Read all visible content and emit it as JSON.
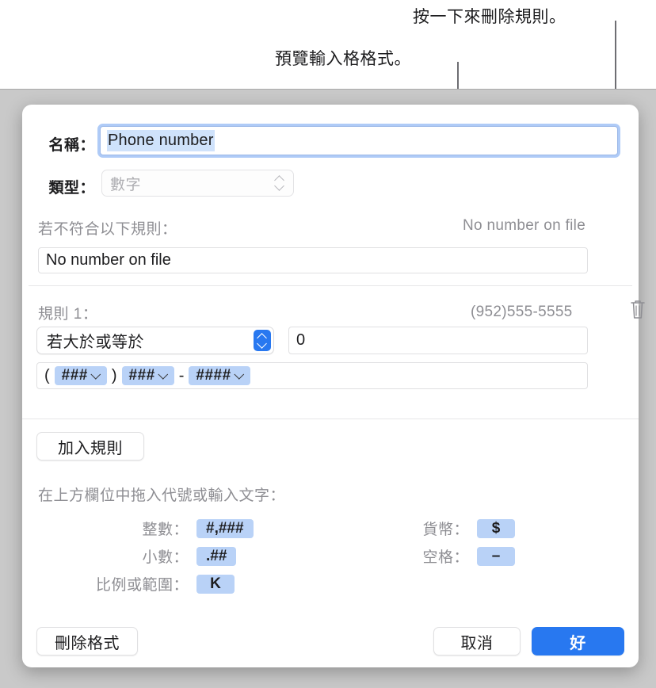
{
  "callouts": {
    "delete_rule": "按一下來刪除規則。",
    "preview_format": "預覽輸入格格式。"
  },
  "dialog": {
    "name": {
      "label": "名稱：",
      "value": "Phone number"
    },
    "type": {
      "label": "類型：",
      "value": "數字",
      "enabled": false
    },
    "unmatched": {
      "label": "若不符合以下規則：",
      "preview": "No number on file",
      "value": "No number on file"
    },
    "rule": {
      "label": "規則 1：",
      "preview": "(952)555-5555",
      "condition": "若大於或等於",
      "value": "0",
      "delete_icon": "trash-icon",
      "format_tokens": [
        {
          "kind": "text",
          "text": "("
        },
        {
          "kind": "token",
          "text": "###"
        },
        {
          "kind": "text",
          "text": ")"
        },
        {
          "kind": "token",
          "text": "###"
        },
        {
          "kind": "text",
          "text": "-"
        },
        {
          "kind": "token",
          "text": "####"
        }
      ]
    },
    "add_rule_label": "加入規則",
    "drag_hint": "在上方欄位中拖入代號或輸入文字：",
    "legend": {
      "integer": {
        "label": "整數：",
        "token": "#,###"
      },
      "decimal": {
        "label": "小數：",
        "token": ".##"
      },
      "scale": {
        "label": "比例或範圍：",
        "token": "K"
      },
      "currency": {
        "label": "貨幣：",
        "token": "$"
      },
      "space": {
        "label": "空格：",
        "token": "–"
      }
    },
    "buttons": {
      "delete_format": "刪除格式",
      "cancel": "取消",
      "ok": "好"
    }
  },
  "colors": {
    "accent": "#2878f0",
    "token_bg": "#b9d2f7",
    "selection_bg": "#cfe2fb",
    "muted_text": "#8e8e93",
    "backdrop": "#c9c9c9"
  }
}
